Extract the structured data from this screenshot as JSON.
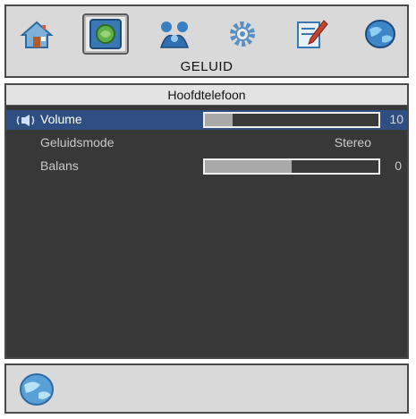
{
  "menu": {
    "title": "GELUID",
    "icons": [
      "home-icon",
      "picture-settings-icon",
      "sound-icon",
      "settings-gear-icon",
      "notes-icon",
      "globe-icon"
    ],
    "selected_icon": "sound-icon"
  },
  "panel": {
    "header": "Hoofdtelefoon",
    "rows": [
      {
        "label": "Volume",
        "value": "10",
        "level_percent": 16,
        "active": true
      },
      {
        "label": "Geluidsmode",
        "value": "Stereo"
      },
      {
        "label": "Balans",
        "value": "0",
        "level_percent": 50
      }
    ]
  },
  "footer": {
    "icon": "globe-icon"
  },
  "colors": {
    "highlight": "#2f4f83",
    "panel_bg": "#383838",
    "frame_bg": "#d9d9d9",
    "text": "#c9c9c9"
  }
}
